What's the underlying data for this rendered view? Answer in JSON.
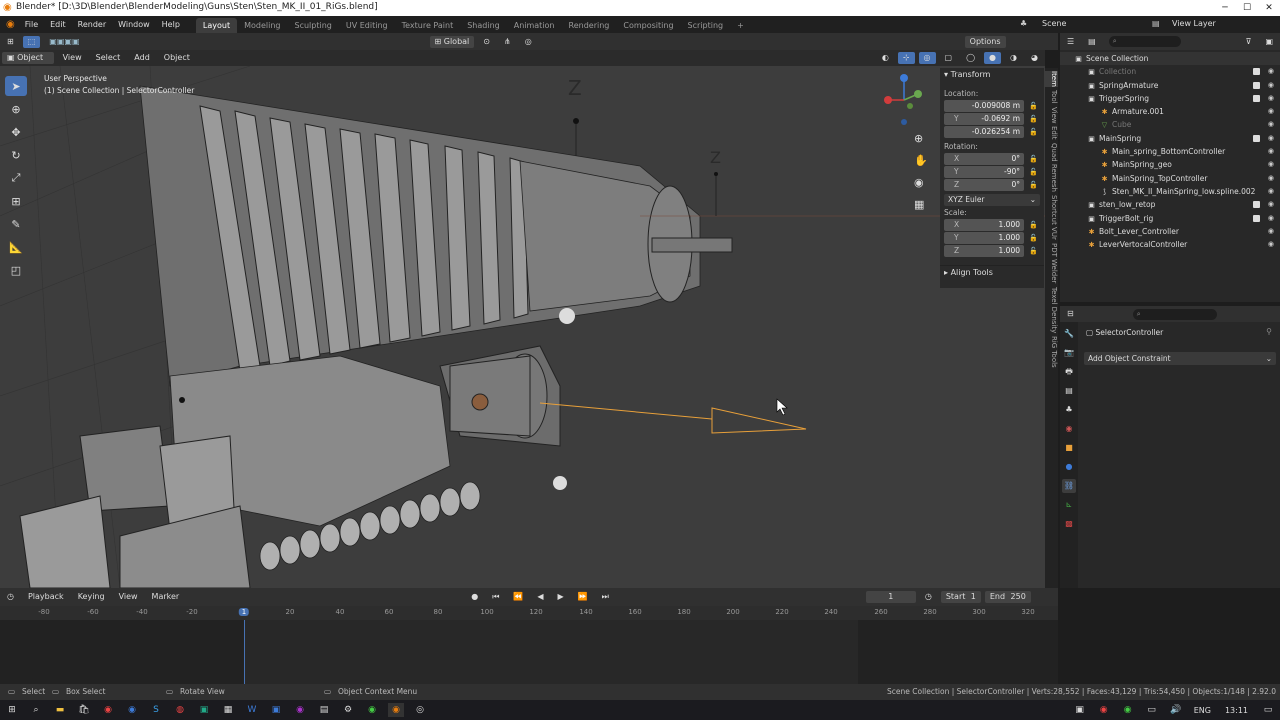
{
  "window": {
    "title": "Blender* [D:\\3D\\Blender\\BlenderModeling\\Guns\\Sten\\Sten_MK_II_01_RiGs.blend]",
    "controls": [
      "─",
      "☐",
      "✕"
    ]
  },
  "menu": {
    "items": [
      "File",
      "Edit",
      "Render",
      "Window",
      "Help"
    ],
    "workspaces": [
      "Layout",
      "Modeling",
      "Sculpting",
      "UV Editing",
      "Texture Paint",
      "Shading",
      "Animation",
      "Rendering",
      "Compositing",
      "Scripting"
    ],
    "active_workspace": "Layout",
    "add_tab": "+",
    "scene": "Scene",
    "view_layer": "View Layer"
  },
  "header3d": {
    "orientation": "Global",
    "options": "Options",
    "mode": "Object Mode",
    "menus": [
      "View",
      "Select",
      "Add",
      "Object"
    ]
  },
  "viewport": {
    "perspective": "User Perspective",
    "context": "(1) Scene Collection | SelectorController",
    "axis_z": "Z"
  },
  "npanel": {
    "transform": "Transform",
    "location_label": "Location:",
    "location": [
      {
        "axis": "",
        "value": "-0.009008 m"
      },
      {
        "axis": "Y",
        "value": "-0.0692 m"
      },
      {
        "axis": "",
        "value": "-0.026254 m"
      }
    ],
    "rotation_label": "Rotation:",
    "rotation": [
      {
        "axis": "X",
        "value": "0°"
      },
      {
        "axis": "Y",
        "value": "-90°"
      },
      {
        "axis": "Z",
        "value": "0°"
      }
    ],
    "rotation_mode": "XYZ Euler",
    "scale_label": "Scale:",
    "scale": [
      {
        "axis": "X",
        "value": "1.000"
      },
      {
        "axis": "Y",
        "value": "1.000"
      },
      {
        "axis": "Z",
        "value": "1.000"
      }
    ],
    "align_tools": "Align Tools"
  },
  "vtabs": [
    "Item",
    "Tool",
    "View",
    "Edit",
    "Quad Remesh",
    "Shortcut VUr",
    "PDT",
    "Welder",
    "Texel Density",
    "RiG Tools"
  ],
  "outliner": {
    "rows": [
      {
        "label": "Scene Collection",
        "indent": 0,
        "icon": "▣",
        "check": false
      },
      {
        "label": "Collection",
        "indent": 1,
        "icon": "▣",
        "check": true,
        "dim": true
      },
      {
        "label": "SpringArmature",
        "indent": 1,
        "icon": "▣",
        "check": true
      },
      {
        "label": "TriggerSpring",
        "indent": 1,
        "icon": "▣",
        "check": true
      },
      {
        "label": "Armature.001",
        "indent": 2,
        "icon": "✱",
        "check": false
      },
      {
        "label": "Cube",
        "indent": 2,
        "icon": "▽",
        "check": false,
        "dim": true
      },
      {
        "label": "MainSpring",
        "indent": 1,
        "icon": "▣",
        "check": true
      },
      {
        "label": "Main_spring_BottomController",
        "indent": 2,
        "icon": "✱",
        "check": false
      },
      {
        "label": "MainSpring_geo",
        "indent": 2,
        "icon": "✱",
        "check": false
      },
      {
        "label": "MainSpring_TopController",
        "indent": 2,
        "icon": "✱",
        "check": false
      },
      {
        "label": "Sten_MK_II_MainSpring_low.spline.002",
        "indent": 2,
        "icon": "⟆",
        "check": false
      },
      {
        "label": "sten_low_retop",
        "indent": 1,
        "icon": "▣",
        "check": true
      },
      {
        "label": "TriggerBolt_rig",
        "indent": 1,
        "icon": "▣",
        "check": true
      },
      {
        "label": "Bolt_Lever_Controller",
        "indent": 1,
        "icon": "✱",
        "check": false
      },
      {
        "label": "LeverVertocalController",
        "indent": 1,
        "icon": "✱",
        "check": false
      }
    ]
  },
  "props": {
    "object": "SelectorController",
    "add_constraint": "Add Object Constraint"
  },
  "timeline": {
    "menus": [
      "Playback",
      "Keying",
      "View",
      "Marker"
    ],
    "frame": "1",
    "start_label": "Start",
    "start": "1",
    "end_label": "End",
    "end": "250",
    "ticks": [
      "-80",
      "-60",
      "-40",
      "-20",
      "1",
      "20",
      "40",
      "60",
      "80",
      "100",
      "120",
      "140",
      "160",
      "180",
      "200",
      "220",
      "240",
      "260",
      "280",
      "300",
      "320"
    ],
    "current": "1"
  },
  "status": {
    "select": "Select",
    "box_select": "Box Select",
    "rotate_view": "Rotate View",
    "context_menu": "Object Context Menu",
    "stats": "Scene Collection | SelectorController | Verts:28,552 | Faces:43,129 | Tris:54,450 | Objects:1/148 | 2.92.0"
  },
  "taskbar": {
    "lang": "ENG",
    "time": "13:11"
  },
  "colors": {
    "accent": "#4772b3",
    "selection": "#e8a03a",
    "viewport_bg": "#3d3d3d"
  }
}
